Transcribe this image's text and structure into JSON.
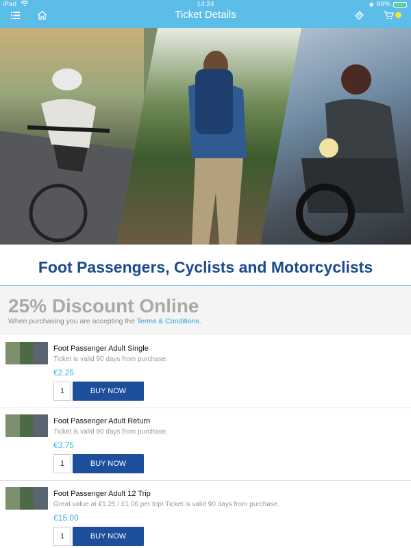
{
  "status_bar": {
    "device": "iPad",
    "time": "14:24",
    "battery_text": "89%",
    "battery_level": 0.89
  },
  "navbar": {
    "title": "Ticket Details",
    "icons": [
      "menu-icon",
      "home-icon",
      "ticket-icon",
      "cart-icon"
    ],
    "cart_badge_color": "#f5e33b"
  },
  "colors": {
    "accent": "#5bbde8",
    "heading": "#1a4a8c",
    "button": "#1d4f9c",
    "price": "#45b7e0"
  },
  "section": {
    "title": "Foot Passengers, Cyclists and Motorcyclists"
  },
  "promo": {
    "headline": "25% Discount Online",
    "text_prefix": "When purchasing you are accepting the ",
    "link": "Terms & Conditions",
    "text_suffix": "."
  },
  "items": [
    {
      "name": "Foot Passenger Adult Single",
      "description": "Ticket is valid 90 days from purchase.",
      "price": "€2.25",
      "quantity": "1",
      "button": "BUY NOW"
    },
    {
      "name": "Foot Passenger Adult Return",
      "description": "Ticket is valid 90 days from purchase.",
      "price": "€3.75",
      "quantity": "1",
      "button": "BUY NOW"
    },
    {
      "name": "Foot Passenger Adult 12 Trip",
      "description": "Great value at €1.25 / £1.06 per trip! Ticket is valid 90 days from purchase.",
      "price": "€15.00",
      "quantity": "1",
      "button": "BUY NOW"
    }
  ]
}
